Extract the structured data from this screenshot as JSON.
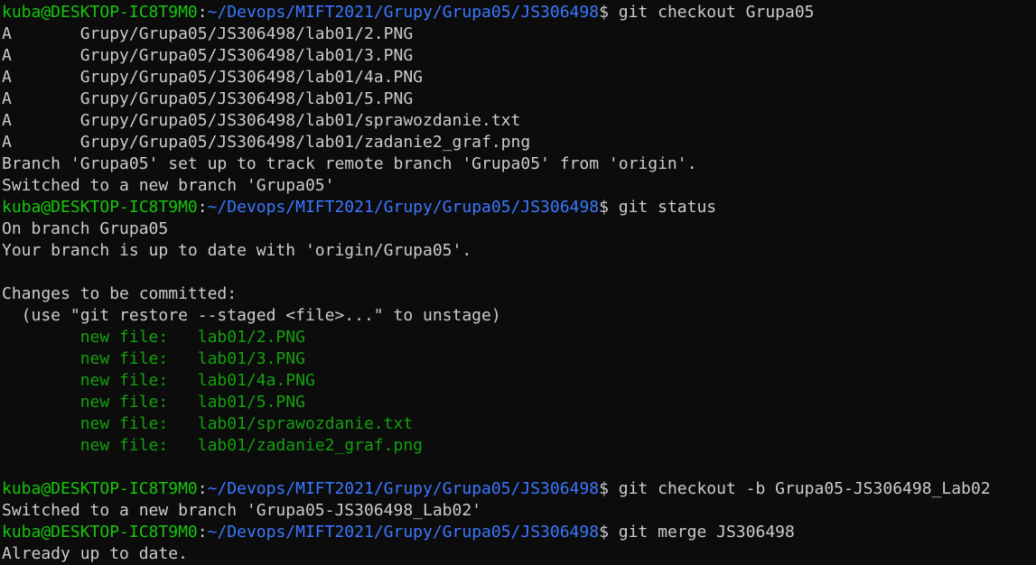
{
  "prompt": {
    "user_host": "kuba@DESKTOP-IC8T9M0",
    "separator": ":",
    "path": "~/Devops/MIFT2021/Grupy/Grupa05/JS306498",
    "symbol": "$"
  },
  "colors": {
    "background": "#0c0c0c",
    "text": "#cccccc",
    "user_host": "#16c60c",
    "path": "#3b78ff",
    "staged_file": "#13a10e"
  },
  "commands": [
    " git checkout Grupa05",
    " git status",
    " git checkout -b Grupa05-JS306498_Lab02",
    " git merge JS306498"
  ],
  "checkout_output": [
    "A       Grupy/Grupa05/JS306498/lab01/2.PNG",
    "A       Grupy/Grupa05/JS306498/lab01/3.PNG",
    "A       Grupy/Grupa05/JS306498/lab01/4a.PNG",
    "A       Grupy/Grupa05/JS306498/lab01/5.PNG",
    "A       Grupy/Grupa05/JS306498/lab01/sprawozdanie.txt",
    "A       Grupy/Grupa05/JS306498/lab01/zadanie2_graf.png",
    "Branch 'Grupa05' set up to track remote branch 'Grupa05' from 'origin'.",
    "Switched to a new branch 'Grupa05'"
  ],
  "status_output": {
    "on_branch": "On branch Grupa05",
    "up_to_date": "Your branch is up to date with 'origin/Grupa05'.",
    "changes_header": "Changes to be committed:",
    "hint": "  (use \"git restore --staged <file>...\" to unstage)",
    "staged_files": [
      "        new file:   lab01/2.PNG",
      "        new file:   lab01/3.PNG",
      "        new file:   lab01/4a.PNG",
      "        new file:   lab01/5.PNG",
      "        new file:   lab01/sprawozdanie.txt",
      "        new file:   lab01/zadanie2_graf.png"
    ]
  },
  "branch_output": "Switched to a new branch 'Grupa05-JS306498_Lab02'",
  "merge_output": "Already up to date."
}
